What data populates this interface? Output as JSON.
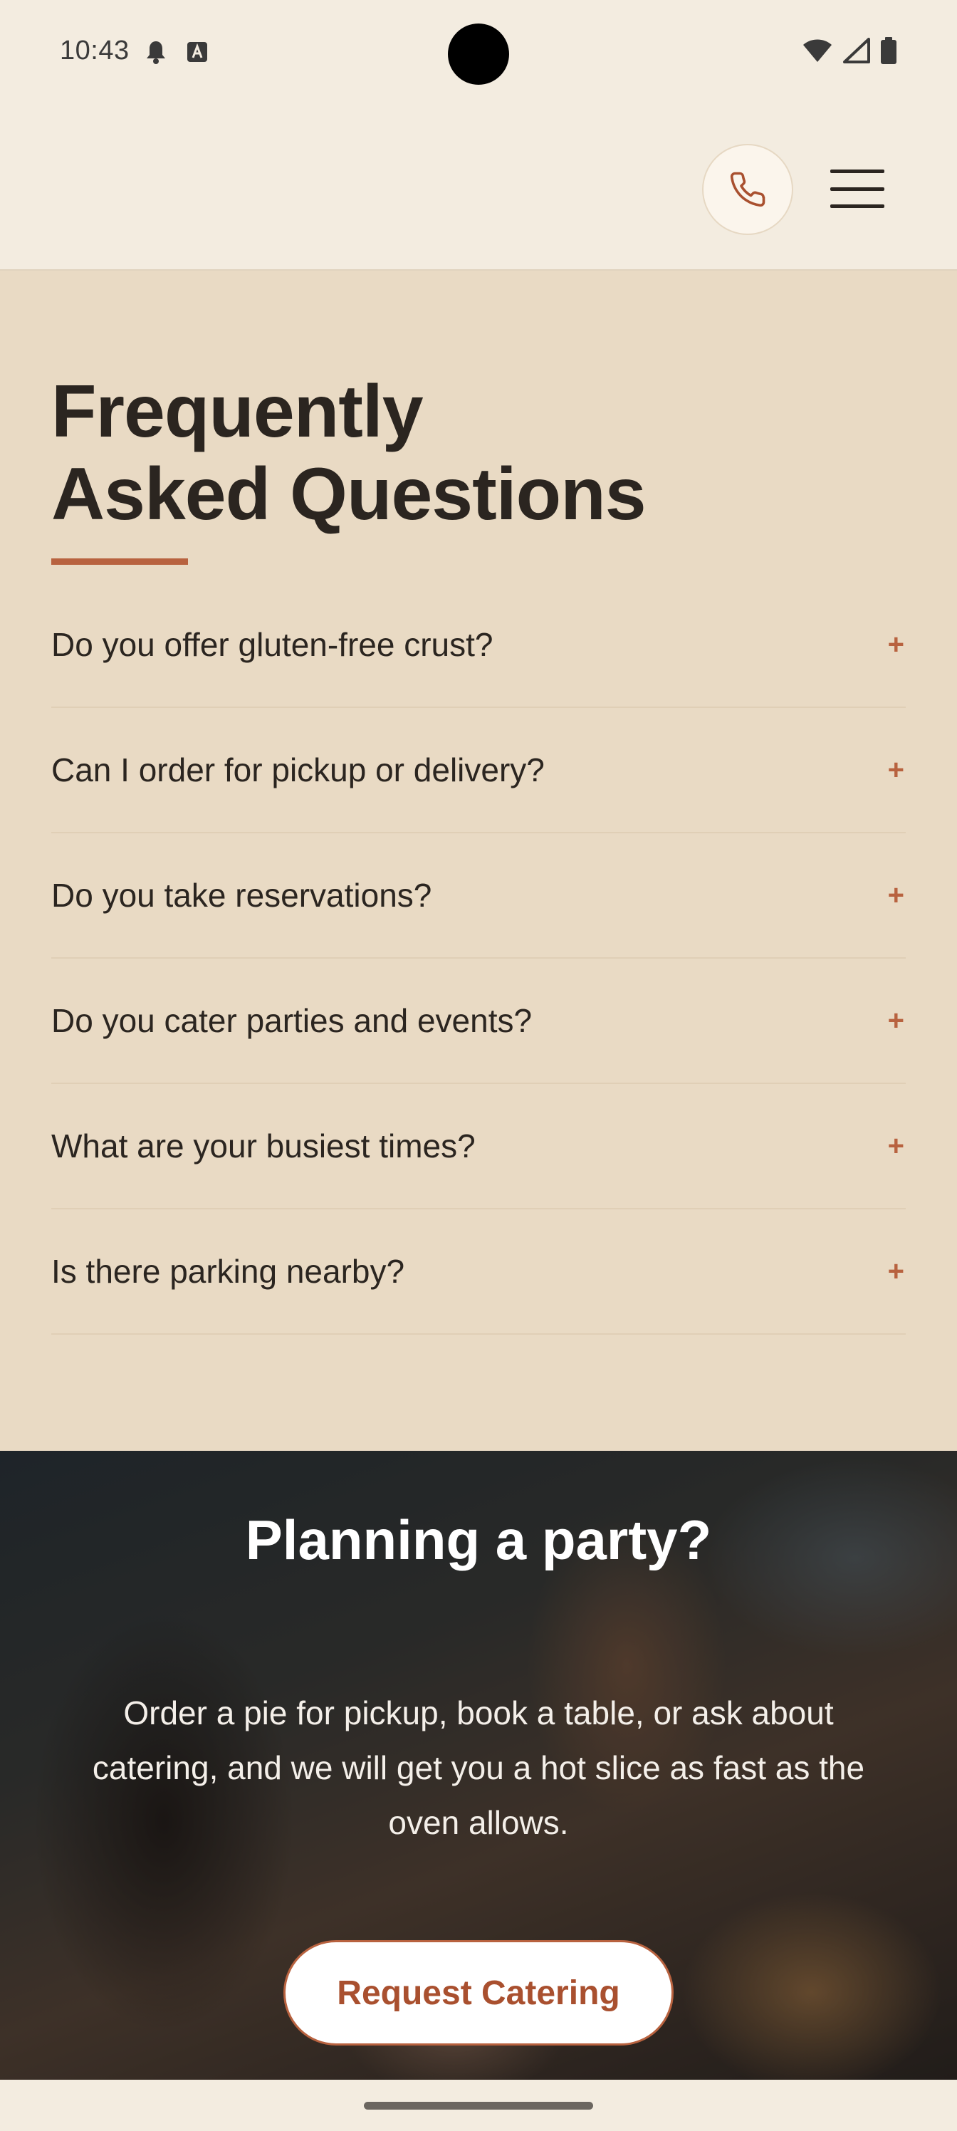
{
  "status_bar": {
    "time": "10:43",
    "left_icons": [
      "notification-bell-icon",
      "font-a-icon"
    ],
    "right_icons": [
      "wifi-icon",
      "signal-icon",
      "battery-icon"
    ]
  },
  "header": {
    "phone_icon": "phone-icon",
    "menu_icon": "hamburger-menu-icon"
  },
  "faq": {
    "title_line1": "Frequently",
    "title_line2": "Asked Questions",
    "items": [
      {
        "question": "Do you offer gluten-free crust?",
        "toggle": "+"
      },
      {
        "question": "Can I order for pickup or delivery?",
        "toggle": "+"
      },
      {
        "question": "Do you take reservations?",
        "toggle": "+"
      },
      {
        "question": "Do you cater parties and events?",
        "toggle": "+"
      },
      {
        "question": "What are your busiest times?",
        "toggle": "+"
      },
      {
        "question": "Is there parking nearby?",
        "toggle": "+"
      }
    ]
  },
  "party": {
    "title": "Planning a party?",
    "body": "Order a pie for pickup, book a table, or ask about catering, and we will get you a hot slice as fast as the oven allows.",
    "cta_label": "Request Catering"
  },
  "colors": {
    "accent": "#b8623f",
    "faq_background": "#e9dac4",
    "page_background": "#f3ece0",
    "text": "#2b2520"
  }
}
